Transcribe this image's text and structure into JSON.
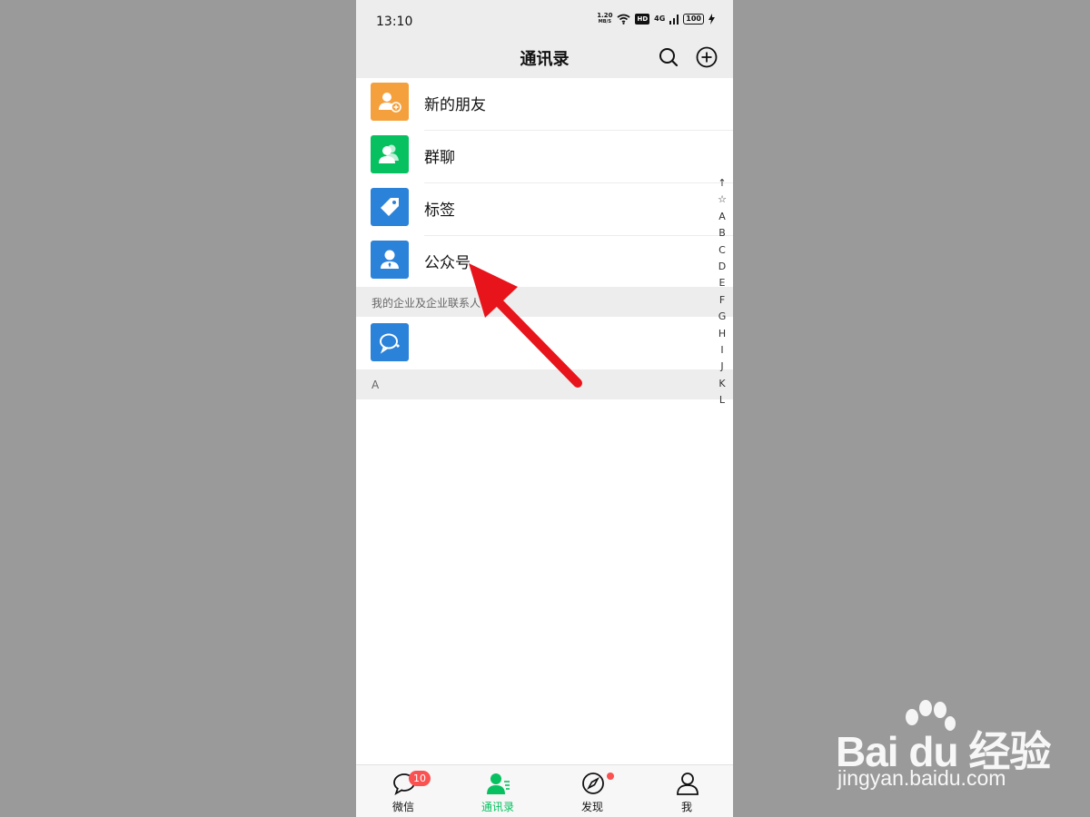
{
  "status": {
    "time": "13:10",
    "net_speed_value": "1.20",
    "net_speed_unit": "MB/S",
    "hd": "HD",
    "signal": "4G",
    "battery": "100"
  },
  "nav": {
    "title": "通讯录",
    "search_icon": "search-icon",
    "add_icon": "plus-circle-icon"
  },
  "entries": [
    {
      "label": "新的朋友",
      "icon": "add-friend-icon",
      "color": "#f4a03c"
    },
    {
      "label": "群聊",
      "icon": "group-chat-icon",
      "color": "#07c160"
    },
    {
      "label": "标签",
      "icon": "tag-icon",
      "color": "#2b82d9"
    },
    {
      "label": "公众号",
      "icon": "official-account-icon",
      "color": "#2b82d9"
    }
  ],
  "enterprise_section": {
    "header": "我的企业及企业联系人",
    "item_icon": "wecom-icon",
    "item_color": "#2b82d9"
  },
  "section_a": "A",
  "index_letters": [
    "↑",
    "☆",
    "A",
    "B",
    "C",
    "D",
    "E",
    "F",
    "G",
    "H",
    "I",
    "J",
    "K",
    "L"
  ],
  "tabs": [
    {
      "label": "微信",
      "icon": "chat-icon",
      "badge": "10"
    },
    {
      "label": "通讯录",
      "icon": "contacts-icon",
      "active": true
    },
    {
      "label": "发现",
      "icon": "compass-icon",
      "dot": true
    },
    {
      "label": "我",
      "icon": "profile-icon"
    }
  ],
  "watermark": {
    "brand": "Bai du 经验",
    "url": "jingyan.baidu.com"
  },
  "colors": {
    "accent": "#07c160",
    "badge": "#fa5151",
    "annotation_arrow": "#e8141b"
  }
}
